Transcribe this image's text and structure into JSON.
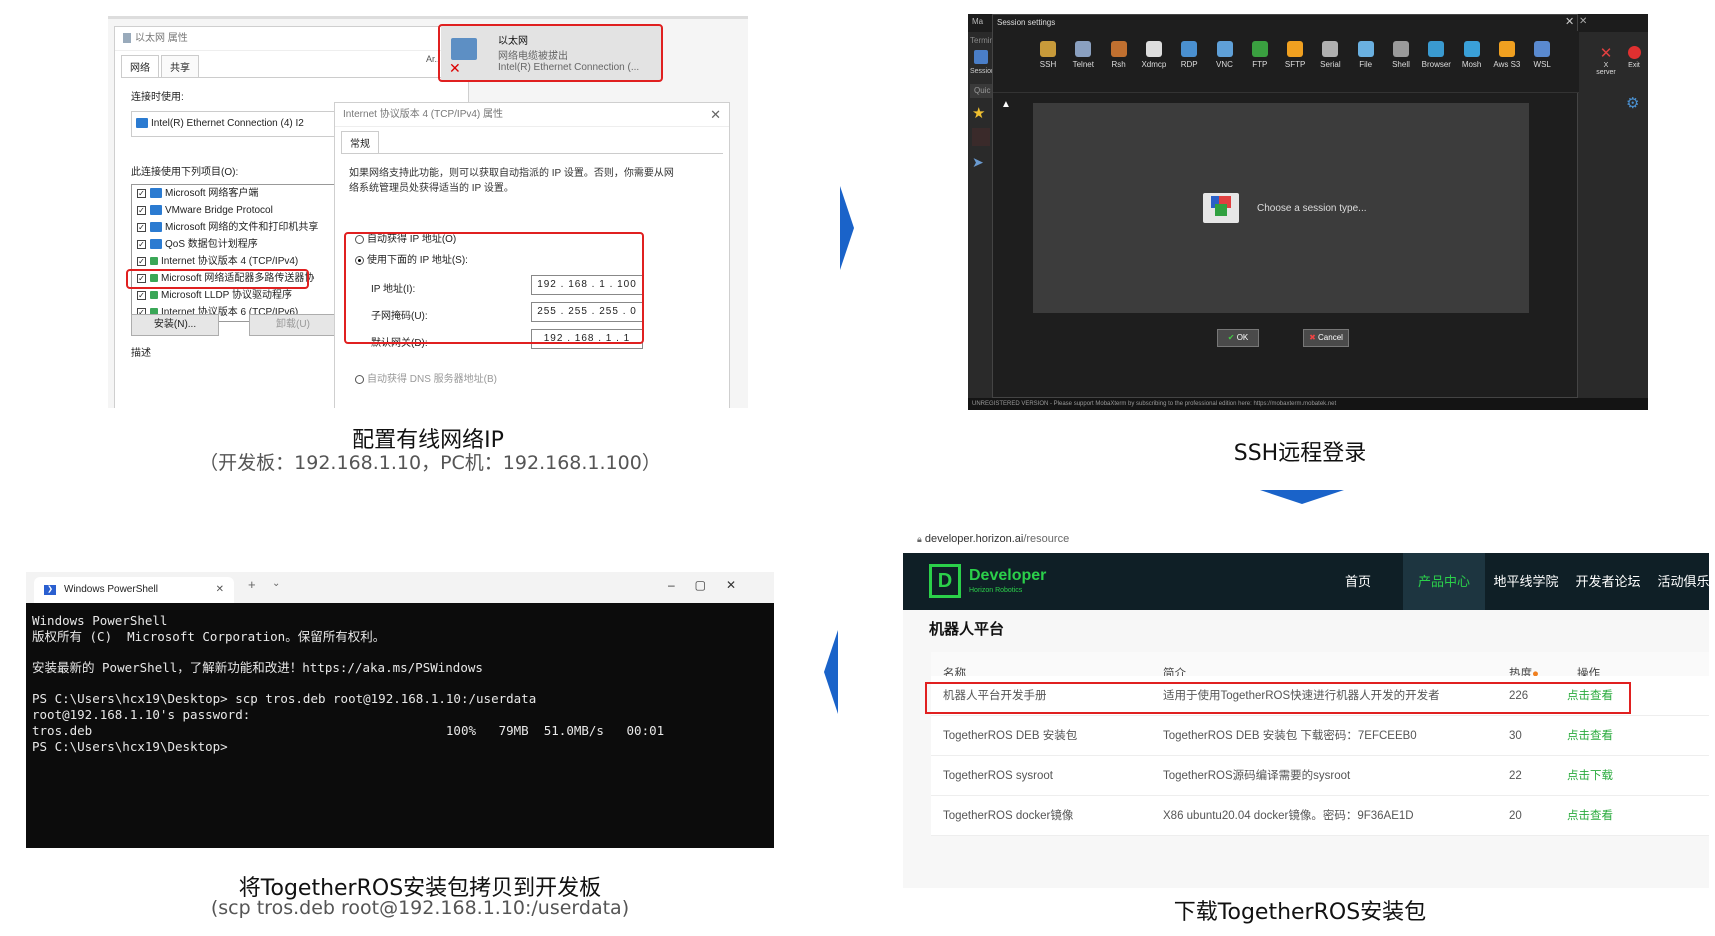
{
  "panel1": {
    "props_title": "以太网 属性",
    "tabs": [
      "网络",
      "共享"
    ],
    "connect_using_label": "连接时使用:",
    "adapter_name": "Intel(R) Ethernet Connection (4) I2",
    "items_label": "此连接使用下列项目(O):",
    "items": [
      "Microsoft 网络客户端",
      "VMware Bridge Protocol",
      "Microsoft 网络的文件和打印机共享",
      "QoS 数据包计划程序",
      "Internet 协议版本 4 (TCP/IPv4)",
      "Microsoft 网络适配器多路传送器协",
      "Microsoft LLDP 协议驱动程序",
      "Internet 协议版本 6 (TCP/IPv6)"
    ],
    "install_label": "安装(N)...",
    "uninstall_label": "卸载(U)",
    "desc_label": "描述",
    "ar_label": "Ar..",
    "adapter_card": {
      "name": "以太网",
      "status": "网络电缆被拔出",
      "device": "Intel(R) Ethernet Connection (..."
    },
    "ipv4": {
      "title": "Internet 协议版本 4 (TCP/IPv4) 属性",
      "tab": "常规",
      "desc": "如果网络支持此功能，则可以获取自动指派的 IP 设置。否则，你需要从网络系统管理员处获得适当的 IP 设置。",
      "auto_ip": "自动获得 IP 地址(O)",
      "manual_ip": "使用下面的 IP 地址(S):",
      "ip_label": "IP 地址(I):",
      "ip_value": "192 . 168 .  1  . 100",
      "mask_label": "子网掩码(U):",
      "mask_value": "255 . 255 . 255 .  0",
      "gw_label": "默认网关(D):",
      "gw_value": "192 . 168 .  1  .  1",
      "dns_auto": "自动获得 DNS 服务器地址(B)"
    },
    "caption": "配置有线网络IP",
    "subcaption": "（开发板：192.168.1.10，PC机：192.168.1.100）"
  },
  "panel2": {
    "app_title": "Ma",
    "terminal_label": "Termin",
    "session_label": "Session",
    "quick_label": "Quic",
    "dialog_title": "Session settings",
    "tools": [
      "SSH",
      "Telnet",
      "Rsh",
      "Xdmcp",
      "RDP",
      "VNC",
      "FTP",
      "SFTP",
      "Serial",
      "File",
      "Shell",
      "Browser",
      "Mosh",
      "Aws S3",
      "WSL"
    ],
    "tool_colors": [
      "#c79a3a",
      "#8aa0c0",
      "#c07030",
      "#dddddd",
      "#4a90d0",
      "#5fa0d8",
      "#3aa040",
      "#f0a020",
      "#b0b0b0",
      "#6ab0e0",
      "#9a9a9a",
      "#3a9ad0",
      "#3aa0d8",
      "#f0a020",
      "#5a8ad0"
    ],
    "xserver_label": "X server",
    "exit_label": "Exit",
    "choose_text": "Choose a session type...",
    "ok_label": "OK",
    "cancel_label": "Cancel",
    "footer": "UNREGISTERED VERSION  -  Please support MobaXterm by subscribing to the professional edition here:  https://mobaxterm.mobatek.net",
    "caption": "SSH远程登录"
  },
  "panel3": {
    "tab_title": "Windows PowerShell",
    "plus": "+",
    "lines": [
      "Windows PowerShell",
      "版权所有 (C)  Microsoft Corporation。保留所有权利。",
      "",
      "安装最新的 PowerShell，了解新功能和改进！https://aka.ms/PSWindows",
      "",
      "PS C:\\Users\\hcx19\\Desktop> scp tros.deb root@192.168.1.10:/userdata",
      "root@192.168.1.10's password:",
      "tros.deb                                               100%   79MB  51.0MB/s   00:01",
      "PS C:\\Users\\hcx19\\Desktop>"
    ],
    "caption": "将TogetherROS安装包拷贝到开发板",
    "subcaption": "(scp tros.deb root@192.168.1.10:/userdata)"
  },
  "panel4": {
    "url_host": "developer.horizon.ai",
    "url_path": "/resource",
    "logo_letter": "D",
    "logo_title": "Developer",
    "logo_sub": "Horizon Robotics",
    "nav": [
      "首页",
      "产品中心",
      "地平线学院",
      "开发者论坛",
      "活动俱乐部"
    ],
    "section_title": "机器人平台",
    "headers": [
      "名称",
      "简介",
      "热度",
      "操作"
    ],
    "rows": [
      {
        "name": "机器人平台开发手册",
        "desc": "适用于使用TogetherROS快速进行机器人开发的开发者",
        "heat": "226",
        "action": "点击查看"
      },
      {
        "name": "TogetherROS DEB 安装包",
        "desc": "TogetherROS DEB 安装包 下载密码：7EFCEEB0",
        "heat": "30",
        "action": "点击查看"
      },
      {
        "name": "TogetherROS sysroot",
        "desc": "TogetherROS源码编译需要的sysroot",
        "heat": "22",
        "action": "点击下载"
      },
      {
        "name": "TogetherROS docker镜像",
        "desc": "X86 ubuntu20.04 docker镜像。密码：9F36AE1D",
        "heat": "20",
        "action": "点击查看"
      }
    ],
    "caption": "下载TogetherROS安装包"
  },
  "colors": {
    "highlight": "#e02020",
    "arrow": "#1a63c9",
    "accent_green": "#2bab3e",
    "nav_bg": "#0f1f26"
  }
}
